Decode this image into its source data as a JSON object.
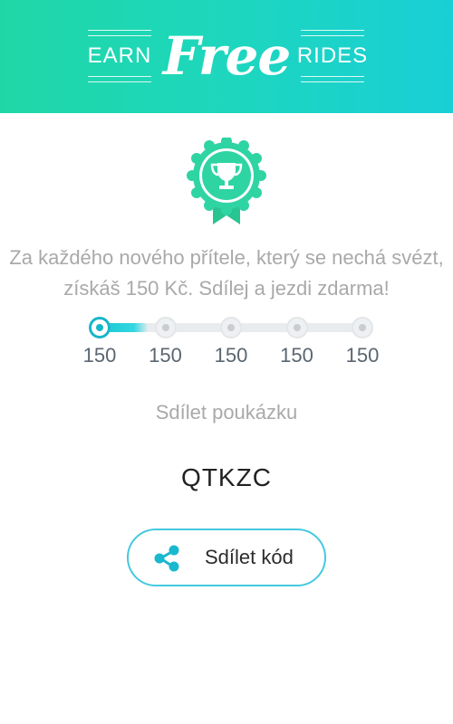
{
  "header": {
    "left_word": "EARN",
    "brand": "Free",
    "right_word": "RIDES",
    "gradient_start": "#1fd7a6",
    "gradient_end": "#19cfd6"
  },
  "badge": {
    "icon": "trophy-icon",
    "color": "#2ed3a1"
  },
  "description": "Za každého nového přítele, který se nechá svézt, získáš 150 Kč. Sdílej a jezdi zdarma!",
  "progress": {
    "steps": [
      "150",
      "150",
      "150",
      "150",
      "150"
    ],
    "completed": 1,
    "active_color": "#16b6c9"
  },
  "share": {
    "title": "Sdílet poukázku",
    "code": "QTKZC",
    "button_label": "Sdílet kód",
    "button_icon": "share-icon",
    "accent": "#45c9df"
  }
}
